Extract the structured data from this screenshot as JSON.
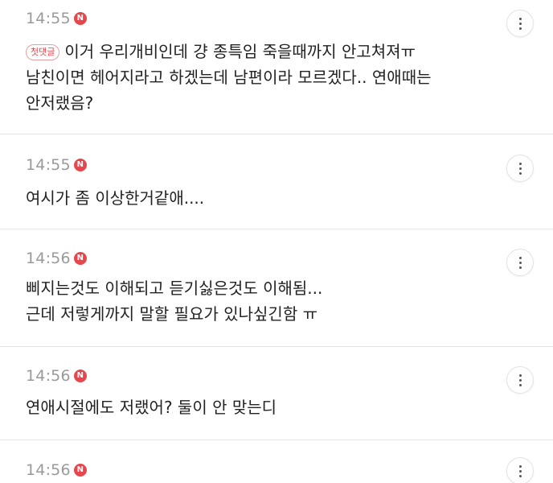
{
  "comments": [
    {
      "time": "14:55",
      "badge": "N",
      "tag": "첫댓글",
      "lines": [
        "이거 우리개비인데 걍 종특임 죽을때까지 안고쳐져ㅠ",
        "남친이면 헤어지라고 하겠는데 남편이라 모르겠다.. 연애때는",
        "안저랬음?"
      ]
    },
    {
      "time": "14:55",
      "badge": "N",
      "lines": [
        "여시가 좀 이상한거같애...."
      ]
    },
    {
      "time": "14:56",
      "badge": "N",
      "lines": [
        "삐지는것도 이해되고 듣기싫은것도 이해됨...",
        "근데 저렇게까지 말할 필요가 있나싶긴함 ㅠ"
      ]
    },
    {
      "time": "14:56",
      "badge": "N",
      "lines": [
        "연애시절에도 저랬어? 둘이 안 맞는디"
      ]
    },
    {
      "time": "14:56",
      "badge": "N",
      "lines": []
    }
  ],
  "icons": {
    "more": "more-vertical-icon",
    "new": "new-badge-icon"
  },
  "colors": {
    "badge": "#e7464c",
    "time": "#9a9a9a",
    "text": "#222222",
    "divider": "#e6e6e6"
  }
}
